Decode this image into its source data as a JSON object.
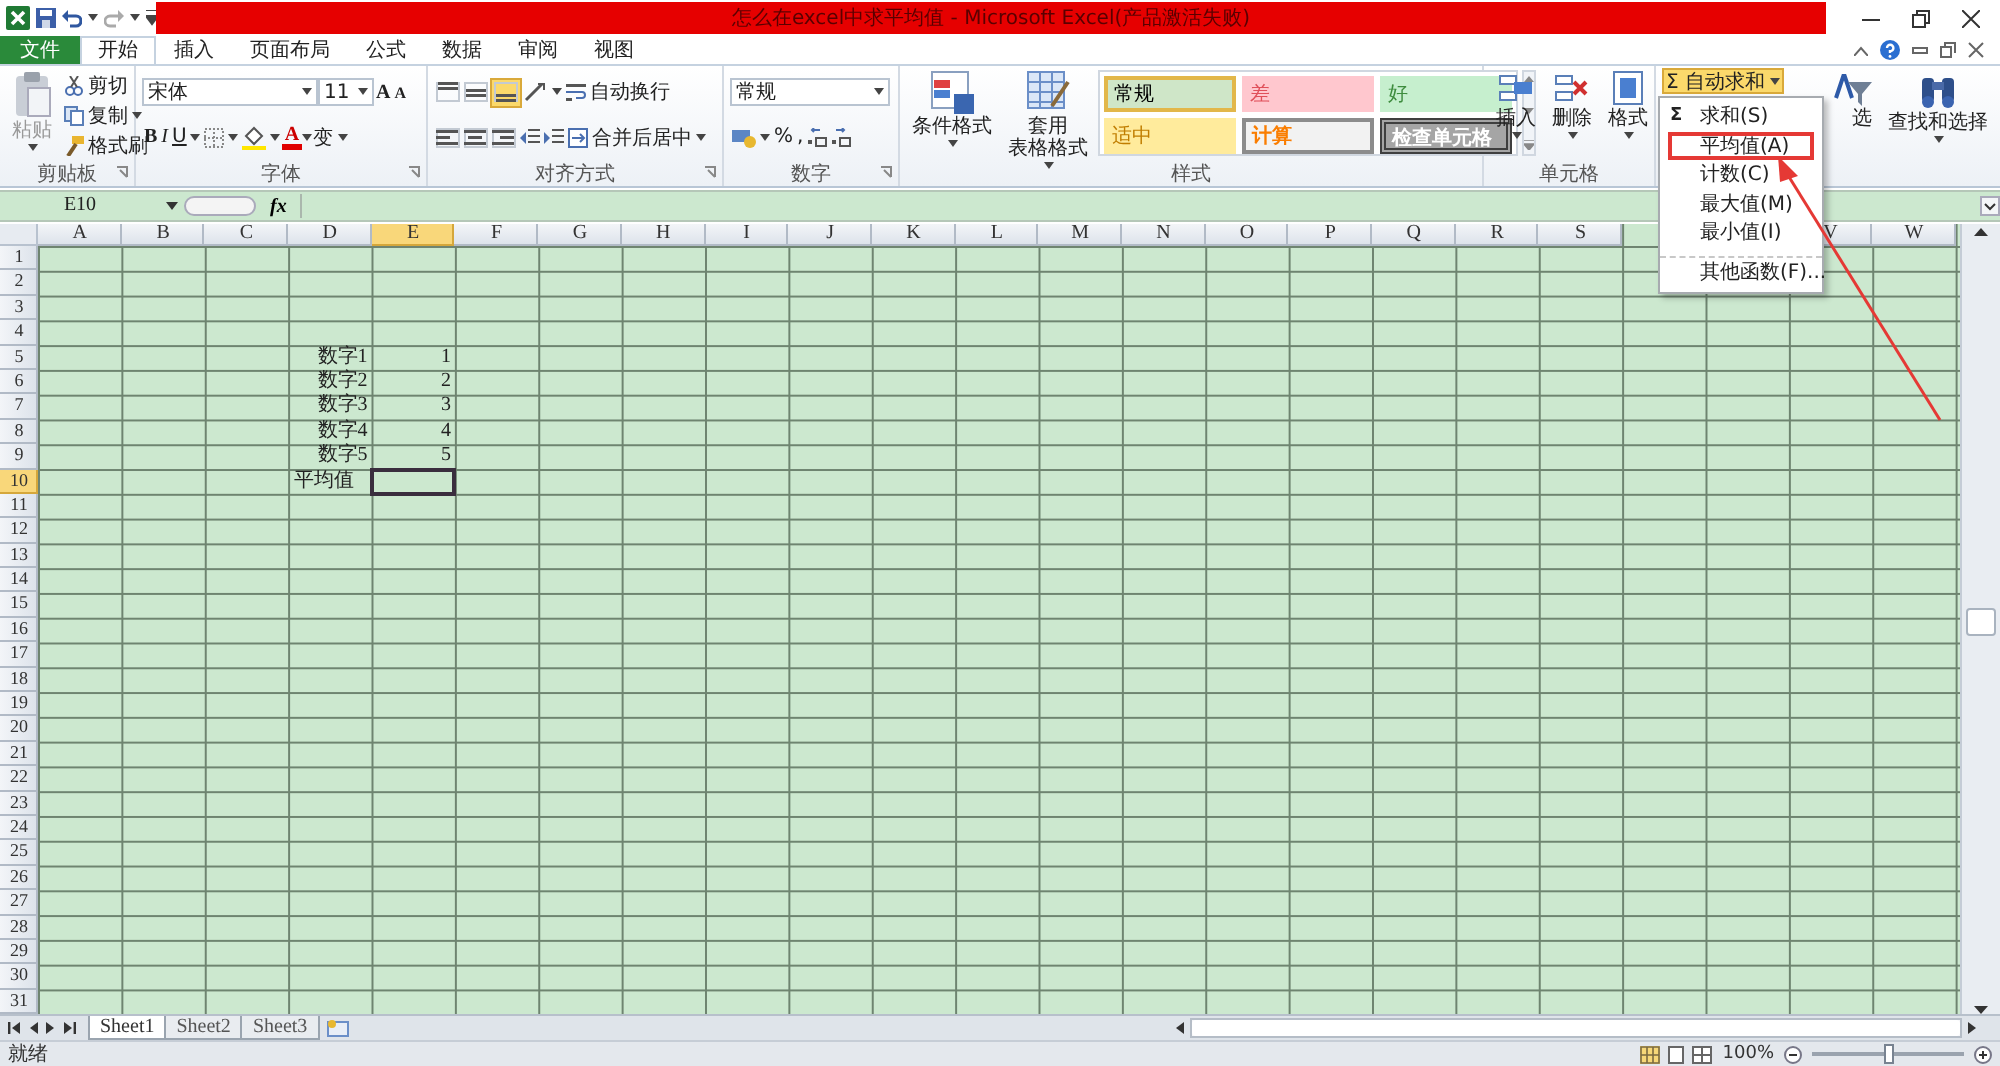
{
  "title_bar": {
    "title": "怎么在excel中求平均值 - Microsoft Excel(产品激活失败)"
  },
  "tabs": [
    {
      "label": "文件",
      "kind": "file",
      "selected": false
    },
    {
      "label": "开始",
      "kind": "tab",
      "selected": true
    },
    {
      "label": "插入",
      "kind": "tab",
      "selected": false
    },
    {
      "label": "页面布局",
      "kind": "tab",
      "selected": false
    },
    {
      "label": "公式",
      "kind": "tab",
      "selected": false
    },
    {
      "label": "数据",
      "kind": "tab",
      "selected": false
    },
    {
      "label": "审阅",
      "kind": "tab",
      "selected": false
    },
    {
      "label": "视图",
      "kind": "tab",
      "selected": false
    }
  ],
  "ribbon": {
    "clipboard": {
      "label": "剪贴板",
      "paste": "粘贴",
      "cut": "剪切",
      "copy": "复制",
      "format_painter": "格式刷"
    },
    "font": {
      "label": "字体",
      "name": "宋体",
      "size": "11",
      "grow": "A",
      "shrink": "A",
      "bold": "B",
      "italic": "I",
      "underline": "U",
      "font_color": "A",
      "phonetic": "变"
    },
    "alignment": {
      "label": "对齐方式",
      "wrap_text": "自动换行",
      "merge_center": "合并后居中"
    },
    "number": {
      "label": "数字",
      "format": "常规",
      "percent": "%",
      "comma": ","
    },
    "styles": {
      "label": "样式",
      "conditional_formatting": "条件格式",
      "format_as_table": [
        "套用",
        "表格格式"
      ],
      "cell_styles": [
        {
          "label": "常规",
          "kind": "normal",
          "selected": true
        },
        {
          "label": "差",
          "kind": "bad",
          "selected": false
        },
        {
          "label": "好",
          "kind": "good",
          "selected": false
        },
        {
          "label": "适中",
          "kind": "neutral",
          "selected": false
        },
        {
          "label": "计算",
          "kind": "calculation",
          "selected": false
        },
        {
          "label": "检查单元格",
          "kind": "check",
          "selected": false
        }
      ]
    },
    "cells": {
      "label": "单元格",
      "insert": "插入",
      "delete": "删除",
      "format": "格式"
    },
    "editing": {
      "autosum": {
        "symbol": "Σ",
        "label": "自动求和"
      },
      "sort_filter": "选",
      "find_select": "查找和选择"
    }
  },
  "autosum_menu": [
    {
      "symbol": "Σ",
      "label": "求和(S)",
      "selected": false,
      "separator_above": false
    },
    {
      "label": "平均值(A)",
      "selected": true,
      "separator_above": false
    },
    {
      "label": "计数(C)",
      "selected": false,
      "separator_above": false
    },
    {
      "label": "最大值(M)",
      "selected": false,
      "separator_above": false
    },
    {
      "label": "最小值(I)",
      "selected": false,
      "separator_above": false
    },
    {
      "label": "其他函数(F)...",
      "selected": false,
      "separator_above": true
    }
  ],
  "formula_bar": {
    "name_box": "E10",
    "function_symbol": "fx"
  },
  "columns": [
    {
      "label": "A",
      "selected": false
    },
    {
      "label": "B",
      "selected": false
    },
    {
      "label": "C",
      "selected": false
    },
    {
      "label": "D",
      "selected": false
    },
    {
      "label": "E",
      "selected": true
    },
    {
      "label": "F",
      "selected": false
    },
    {
      "label": "G",
      "selected": false
    },
    {
      "label": "H",
      "selected": false
    },
    {
      "label": "I",
      "selected": false
    },
    {
      "label": "J",
      "selected": false
    },
    {
      "label": "K",
      "selected": false
    },
    {
      "label": "L",
      "selected": false
    },
    {
      "label": "M",
      "selected": false
    },
    {
      "label": "N",
      "selected": false
    },
    {
      "label": "O",
      "selected": false
    },
    {
      "label": "P",
      "selected": false
    },
    {
      "label": "Q",
      "selected": false
    },
    {
      "label": "R",
      "selected": false
    },
    {
      "label": "S",
      "selected": false
    },
    {
      "label": "V",
      "selected": false
    },
    {
      "label": "W",
      "selected": false
    }
  ],
  "rows": [
    {
      "header": "1",
      "selected": false
    },
    {
      "header": "2",
      "selected": false
    },
    {
      "header": "3",
      "selected": false
    },
    {
      "header": "4",
      "selected": false
    },
    {
      "header": "5",
      "selected": false,
      "cells": {
        "D": "数字1",
        "E": "1"
      }
    },
    {
      "header": "6",
      "selected": false,
      "cells": {
        "D": "数字2",
        "E": "2"
      }
    },
    {
      "header": "7",
      "selected": false,
      "cells": {
        "D": "数字3",
        "E": "3"
      }
    },
    {
      "header": "8",
      "selected": false,
      "cells": {
        "D": "数字4",
        "E": "4"
      }
    },
    {
      "header": "9",
      "selected": false,
      "cells": {
        "D": "数字5",
        "E": "5"
      }
    },
    {
      "header": "10",
      "selected": true,
      "cells": {
        "D": "平均值"
      }
    },
    {
      "header": "11",
      "selected": false
    },
    {
      "header": "12",
      "selected": false
    },
    {
      "header": "13",
      "selected": false
    },
    {
      "header": "14",
      "selected": false
    },
    {
      "header": "15",
      "selected": false
    },
    {
      "header": "16",
      "selected": false
    },
    {
      "header": "17",
      "selected": false
    },
    {
      "header": "18",
      "selected": false
    },
    {
      "header": "19",
      "selected": false
    },
    {
      "header": "20",
      "selected": false
    },
    {
      "header": "21",
      "selected": false
    },
    {
      "header": "22",
      "selected": false
    },
    {
      "header": "23",
      "selected": false
    },
    {
      "header": "24",
      "selected": false
    },
    {
      "header": "25",
      "selected": false
    },
    {
      "header": "26",
      "selected": false
    },
    {
      "header": "27",
      "selected": false
    },
    {
      "header": "28",
      "selected": false
    },
    {
      "header": "29",
      "selected": false
    },
    {
      "header": "30",
      "selected": false
    },
    {
      "header": "31",
      "selected": false
    }
  ],
  "sheet_tabs": [
    {
      "label": "Sheet1",
      "selected": true
    },
    {
      "label": "Sheet2",
      "selected": false
    },
    {
      "label": "Sheet3",
      "selected": false
    }
  ],
  "status_bar": {
    "status": "就绪",
    "zoom": "100%",
    "zoom_slider": {
      "level": 0.5
    }
  }
}
